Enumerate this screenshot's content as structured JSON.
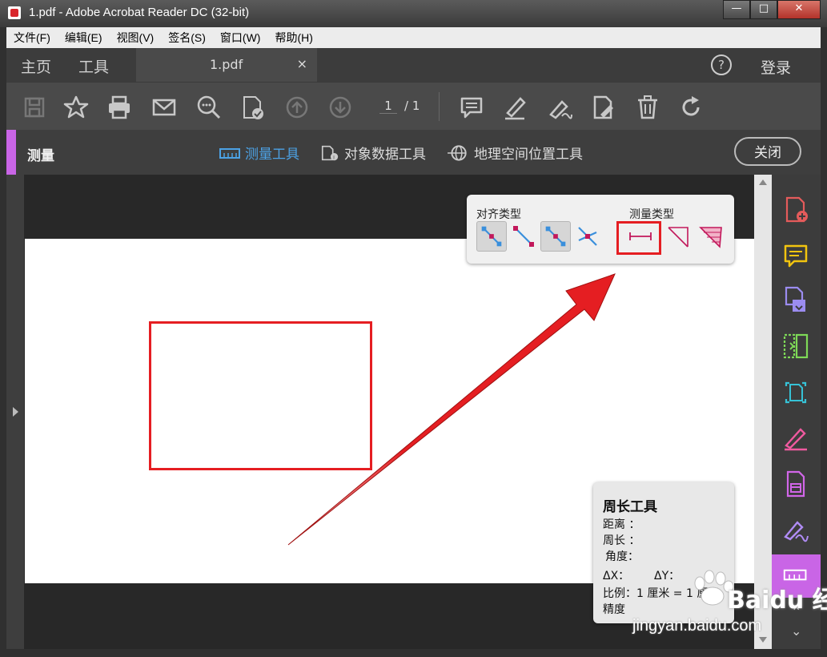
{
  "window": {
    "title": "1.pdf - Adobe Acrobat Reader DC (32-bit)",
    "min": "—",
    "max": "□",
    "close": "✕"
  },
  "menu": [
    "文件(F)",
    "编辑(E)",
    "视图(V)",
    "签名(S)",
    "窗口(W)",
    "帮助(H)"
  ],
  "tabs": {
    "home": "主页",
    "tools": "工具",
    "doc": "1.pdf",
    "doc_close": "×",
    "help": "?",
    "login": "登录"
  },
  "toolbar": {
    "page_current": "1",
    "page_total": "/ 1"
  },
  "measure_bar": {
    "title": "测量",
    "tools": [
      "测量工具",
      "对象数据工具",
      "地理空间位置工具"
    ],
    "close": "关闭",
    "accent": "#c965e6",
    "active_color": "#4ca2e5"
  },
  "popup": {
    "align_label": "对齐类型",
    "measure_label": "测量类型"
  },
  "panel": {
    "title": "周长工具",
    "distance": "距离 ：",
    "perimeter": "周长 ：",
    "angle": "角度：",
    "dx": "ΔX：",
    "dy": "ΔY：",
    "scale": "比例：1 厘米 = 1 厘米",
    "precision": "精度"
  },
  "watermark": {
    "brand": "Baidu 经验",
    "url": "jingyan.baidu.com"
  },
  "colors": {
    "annotation_red": "#e51e22"
  }
}
